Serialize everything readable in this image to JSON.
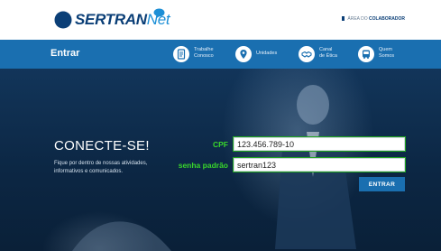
{
  "header": {
    "logo_text": "SERTRAN",
    "logo_text_suffix": "Net",
    "collab_prefix": "ÁREA DO",
    "collab_strong": "COLABORADOR"
  },
  "nav": {
    "title": "Entrar",
    "items": [
      {
        "label": "Trabalhe\nConosco",
        "icon": "document-icon"
      },
      {
        "label": "Unidades",
        "icon": "location-pin-icon"
      },
      {
        "label": "Canal\nde Ética",
        "icon": "handshake-icon"
      },
      {
        "label": "Quem\nSomos",
        "icon": "bus-icon"
      }
    ]
  },
  "hero": {
    "heading": "CONECTE-SE!",
    "subtext": "Fique por dentro de nossas atividades, informativos e comunicados."
  },
  "login": {
    "cpf_label": "CPF",
    "cpf_value": "123.456.789-10",
    "password_label": "senha padrão",
    "password_value": "sertran123",
    "submit_label": "ENTRAR"
  },
  "colors": {
    "brand_blue": "#1a6fb0",
    "logo_navy": "#0b3f77",
    "annotation_green": "#39d62b"
  }
}
